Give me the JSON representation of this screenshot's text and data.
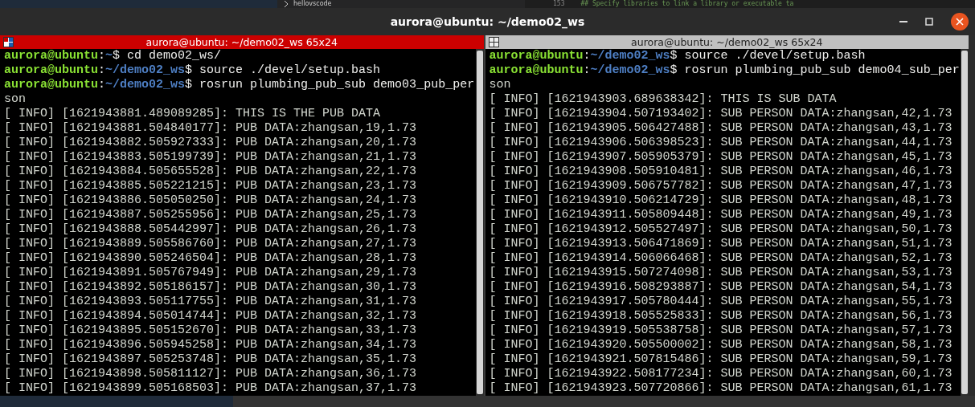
{
  "background": {
    "tree_item": "hellovscode",
    "line_number": "153",
    "code": "## Specify libraries to link a library or executable ta"
  },
  "window": {
    "title": "aurora@ubuntu: ~/demo02_ws"
  },
  "panes": [
    {
      "title": "aurora@ubuntu: ~/demo02_ws 65x24",
      "active": true,
      "lines": [
        {
          "kind": "prompt",
          "user": "aurora@ubuntu",
          "sep": ":",
          "path": "~",
          "command": "$ cd demo02_ws/"
        },
        {
          "kind": "prompt",
          "user": "aurora@ubuntu",
          "sep": ":",
          "path": "~/demo02_ws",
          "command": "$ source ./devel/setup.bash"
        },
        {
          "kind": "prompt",
          "user": "aurora@ubuntu",
          "sep": ":",
          "path": "~/demo02_ws",
          "command": "$ rosrun plumbing_pub_sub demo03_pub_per"
        },
        {
          "kind": "output",
          "text": "son"
        },
        {
          "kind": "output",
          "text": "[ INFO] [1621943881.489089285]: THIS IS THE PUB DATA"
        },
        {
          "kind": "output",
          "text": "[ INFO] [1621943881.504840177]: PUB DATA:zhangsan,19,1.73"
        },
        {
          "kind": "output",
          "text": "[ INFO] [1621943882.505927333]: PUB DATA:zhangsan,20,1.73"
        },
        {
          "kind": "output",
          "text": "[ INFO] [1621943883.505199739]: PUB DATA:zhangsan,21,1.73"
        },
        {
          "kind": "output",
          "text": "[ INFO] [1621943884.505655528]: PUB DATA:zhangsan,22,1.73"
        },
        {
          "kind": "output",
          "text": "[ INFO] [1621943885.505221215]: PUB DATA:zhangsan,23,1.73"
        },
        {
          "kind": "output",
          "text": "[ INFO] [1621943886.505050250]: PUB DATA:zhangsan,24,1.73"
        },
        {
          "kind": "output",
          "text": "[ INFO] [1621943887.505255956]: PUB DATA:zhangsan,25,1.73"
        },
        {
          "kind": "output",
          "text": "[ INFO] [1621943888.505442997]: PUB DATA:zhangsan,26,1.73"
        },
        {
          "kind": "output",
          "text": "[ INFO] [1621943889.505586760]: PUB DATA:zhangsan,27,1.73"
        },
        {
          "kind": "output",
          "text": "[ INFO] [1621943890.505246504]: PUB DATA:zhangsan,28,1.73"
        },
        {
          "kind": "output",
          "text": "[ INFO] [1621943891.505767949]: PUB DATA:zhangsan,29,1.73"
        },
        {
          "kind": "output",
          "text": "[ INFO] [1621943892.505186157]: PUB DATA:zhangsan,30,1.73"
        },
        {
          "kind": "output",
          "text": "[ INFO] [1621943893.505117755]: PUB DATA:zhangsan,31,1.73"
        },
        {
          "kind": "output",
          "text": "[ INFO] [1621943894.505014744]: PUB DATA:zhangsan,32,1.73"
        },
        {
          "kind": "output",
          "text": "[ INFO] [1621943895.505152670]: PUB DATA:zhangsan,33,1.73"
        },
        {
          "kind": "output",
          "text": "[ INFO] [1621943896.505945258]: PUB DATA:zhangsan,34,1.73"
        },
        {
          "kind": "output",
          "text": "[ INFO] [1621943897.505253748]: PUB DATA:zhangsan,35,1.73"
        },
        {
          "kind": "output",
          "text": "[ INFO] [1621943898.505811127]: PUB DATA:zhangsan,36,1.73"
        },
        {
          "kind": "output",
          "text": "[ INFO] [1621943899.505168503]: PUB DATA:zhangsan,37,1.73"
        }
      ]
    },
    {
      "title": "aurora@ubuntu: ~/demo02_ws 65x24",
      "active": false,
      "lines": [
        {
          "kind": "prompt",
          "user": "aurora@ubuntu",
          "sep": ":",
          "path": "~/demo02_ws",
          "command": "$ source ./devel/setup.bash"
        },
        {
          "kind": "prompt",
          "user": "aurora@ubuntu",
          "sep": ":",
          "path": "~/demo02_ws",
          "command": "$ rosrun plumbing_pub_sub demo04_sub_per"
        },
        {
          "kind": "output",
          "text": "son"
        },
        {
          "kind": "output",
          "text": "[ INFO] [1621943903.689638342]: THIS IS SUB DATA"
        },
        {
          "kind": "output",
          "text": "[ INFO] [1621943904.507193402]: SUB PERSON DATA:zhangsan,42,1.73"
        },
        {
          "kind": "output",
          "text": "[ INFO] [1621943905.506427488]: SUB PERSON DATA:zhangsan,43,1.73"
        },
        {
          "kind": "output",
          "text": "[ INFO] [1621943906.506398523]: SUB PERSON DATA:zhangsan,44,1.73"
        },
        {
          "kind": "output",
          "text": "[ INFO] [1621943907.505905379]: SUB PERSON DATA:zhangsan,45,1.73"
        },
        {
          "kind": "output",
          "text": "[ INFO] [1621943908.505910481]: SUB PERSON DATA:zhangsan,46,1.73"
        },
        {
          "kind": "output",
          "text": "[ INFO] [1621943909.506757782]: SUB PERSON DATA:zhangsan,47,1.73"
        },
        {
          "kind": "output",
          "text": "[ INFO] [1621943910.506214729]: SUB PERSON DATA:zhangsan,48,1.73"
        },
        {
          "kind": "output",
          "text": "[ INFO] [1621943911.505809448]: SUB PERSON DATA:zhangsan,49,1.73"
        },
        {
          "kind": "output",
          "text": "[ INFO] [1621943912.505527497]: SUB PERSON DATA:zhangsan,50,1.73"
        },
        {
          "kind": "output",
          "text": "[ INFO] [1621943913.506471869]: SUB PERSON DATA:zhangsan,51,1.73"
        },
        {
          "kind": "output",
          "text": "[ INFO] [1621943914.506066468]: SUB PERSON DATA:zhangsan,52,1.73"
        },
        {
          "kind": "output",
          "text": "[ INFO] [1621943915.507274098]: SUB PERSON DATA:zhangsan,53,1.73"
        },
        {
          "kind": "output",
          "text": "[ INFO] [1621943916.508293887]: SUB PERSON DATA:zhangsan,54,1.73"
        },
        {
          "kind": "output",
          "text": "[ INFO] [1621943917.505780444]: SUB PERSON DATA:zhangsan,55,1.73"
        },
        {
          "kind": "output",
          "text": "[ INFO] [1621943918.505525833]: SUB PERSON DATA:zhangsan,56,1.73"
        },
        {
          "kind": "output",
          "text": "[ INFO] [1621943919.505538758]: SUB PERSON DATA:zhangsan,57,1.73"
        },
        {
          "kind": "output",
          "text": "[ INFO] [1621943920.505500002]: SUB PERSON DATA:zhangsan,58,1.73"
        },
        {
          "kind": "output",
          "text": "[ INFO] [1621943921.507815486]: SUB PERSON DATA:zhangsan,59,1.73"
        },
        {
          "kind": "output",
          "text": "[ INFO] [1621943922.508177234]: SUB PERSON DATA:zhangsan,60,1.73"
        },
        {
          "kind": "output",
          "text": "[ INFO] [1621943923.507720866]: SUB PERSON DATA:zhangsan,61,1.73"
        }
      ]
    }
  ]
}
